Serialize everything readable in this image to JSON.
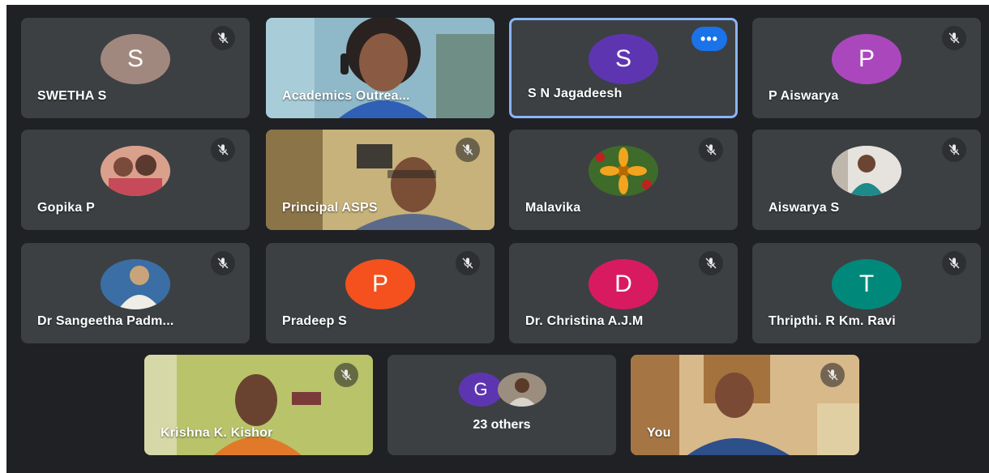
{
  "tiles": [
    {
      "name": "SWETHA S",
      "initial": "S",
      "color": "#a1887f"
    },
    {
      "name": "Academics Outrea..."
    },
    {
      "name": "S N Jagadeesh",
      "initial": "S",
      "color": "#5e35b1"
    },
    {
      "name": "P Aiswarya",
      "initial": "P",
      "color": "#ab47bc"
    },
    {
      "name": "Gopika P"
    },
    {
      "name": "Principal ASPS"
    },
    {
      "name": "Malavika"
    },
    {
      "name": "Aiswarya S"
    },
    {
      "name": "Dr Sangeetha Padm..."
    },
    {
      "name": "Pradeep S",
      "initial": "P",
      "color": "#f4511e"
    },
    {
      "name": "Dr. Christina A.J.M",
      "initial": "D",
      "color": "#d81b60"
    },
    {
      "name": "Thripthi. R Km. Ravi",
      "initial": "T",
      "color": "#00897b"
    },
    {
      "name": "Krishna K. Kishor"
    },
    {
      "name": "You"
    }
  ],
  "others": {
    "label": "23 others",
    "initial": "G",
    "color": "#5e35b1"
  },
  "more_button": "•••",
  "icons": {
    "mic_off": "mic-off-icon",
    "more": "more-options-icon"
  },
  "colors": {
    "stage": "#202124",
    "tile": "#3c4043",
    "active_border": "#8ab4f8",
    "accent": "#1a73e8"
  }
}
